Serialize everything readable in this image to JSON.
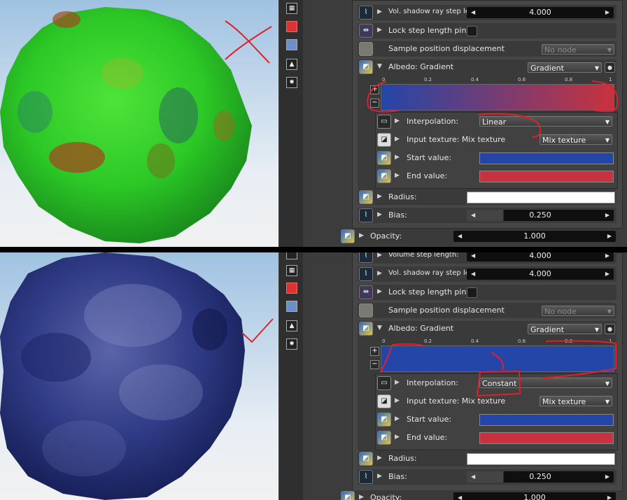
{
  "colors": {
    "start": "#2446a8",
    "end": "#c8323e",
    "annot": "#e0202a",
    "check": "#d42a2e"
  },
  "icons": [
    "texture-render-icon",
    "red-cube-icon",
    "layers-icon",
    "image-icon",
    "sun-icon"
  ],
  "top": {
    "vol_label": "Vol. shadow ray step length:",
    "vol_value": "4.000",
    "lock_label": "Lock step length pins:",
    "spd_label": "Sample position displacement",
    "spd_value": "No node",
    "albedo_label": "Albedo: Gradient",
    "albedo_value": "Gradient",
    "ticks": [
      "0",
      "0.2",
      "0.4",
      "0.6",
      "0.8",
      "1"
    ],
    "interp_label": "Interpolation:",
    "interp_value": "Linear",
    "input_label": "Input texture: Mix texture",
    "input_value": "Mix texture",
    "start_label": "Start value:",
    "end_label": "End value:",
    "radius_label": "Radius:",
    "bias_label": "Bias:",
    "bias_value": "0.250",
    "opacity_label": "Opacity:",
    "opacity_value": "1.000"
  },
  "bottom": {
    "volstep_label": "Volume step length:",
    "volstep_value": "4.000",
    "vol_label": "Vol. shadow ray step length:",
    "vol_value": "4.000",
    "lock_label": "Lock step length pins:",
    "spd_label": "Sample position displacement",
    "spd_value": "No node",
    "albedo_label": "Albedo: Gradient",
    "albedo_value": "Gradient",
    "ticks": [
      "0",
      "0.2",
      "0.4",
      "0.6",
      "0.8",
      "1"
    ],
    "interp_label": "Interpolation:",
    "interp_value": "Constant",
    "input_label": "Input texture: Mix texture",
    "input_value": "Mix texture",
    "start_label": "Start value:",
    "end_label": "End value:",
    "radius_label": "Radius:",
    "bias_label": "Bias:",
    "bias_value": "0.250",
    "opacity_label": "Opacity:",
    "opacity_value": "1.000"
  }
}
